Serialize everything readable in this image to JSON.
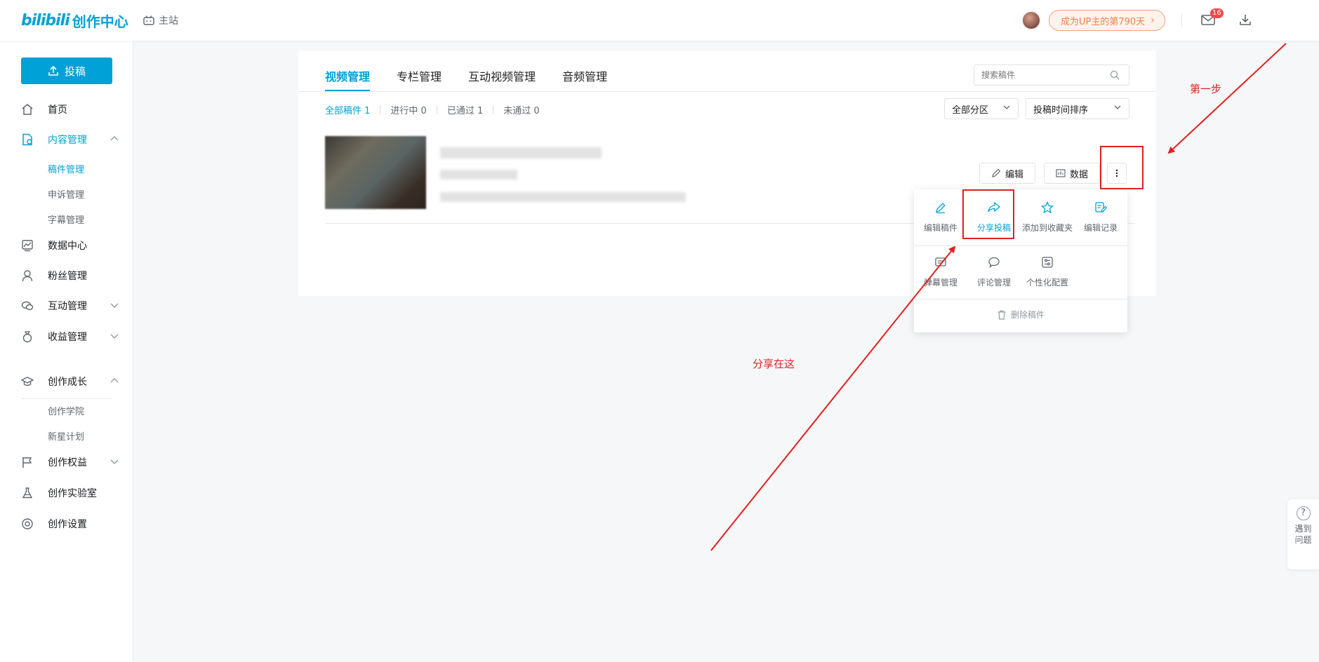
{
  "header": {
    "logo_brand": "bilibili",
    "logo_title": "创作中心",
    "main_site": "主站",
    "up_badge": "成为UP主的第790天",
    "message_count": "16"
  },
  "sidebar": {
    "upload": "投稿",
    "items": [
      {
        "label": "首页"
      },
      {
        "label": "内容管理"
      },
      {
        "label": "数据中心"
      },
      {
        "label": "粉丝管理"
      },
      {
        "label": "互动管理"
      },
      {
        "label": "收益管理"
      },
      {
        "label": "创作成长"
      },
      {
        "label": "创作权益"
      },
      {
        "label": "创作实验室"
      },
      {
        "label": "创作设置"
      }
    ],
    "content_sub": [
      "稿件管理",
      "申诉管理",
      "字幕管理"
    ],
    "growth_sub": [
      "创作学院",
      "新星计划"
    ]
  },
  "main": {
    "tabs": [
      "视频管理",
      "专栏管理",
      "互动视频管理",
      "音频管理"
    ],
    "search_placeholder": "搜索稿件",
    "filters": [
      "全部稿件 1",
      "进行中 0",
      "已通过 1",
      "未通过 0"
    ],
    "category_select": "全部分区",
    "sort_select": "投稿时间排序",
    "edit_button": "编辑",
    "data_button": "数据"
  },
  "popup_menu": {
    "row1": [
      "编辑稿件",
      "分享投稿",
      "添加到收藏夹",
      "编辑记录"
    ],
    "row2": [
      "弹幕管理",
      "评论管理",
      "个性化配置"
    ],
    "delete": "删除稿件"
  },
  "annotations": {
    "step1": "第一步",
    "share_here": "分享在这"
  },
  "help": {
    "line1": "遇到",
    "line2": "问题"
  },
  "colors": {
    "accent": "#00a1d6",
    "annotation": "#e02020",
    "badge": "#f0824a"
  }
}
